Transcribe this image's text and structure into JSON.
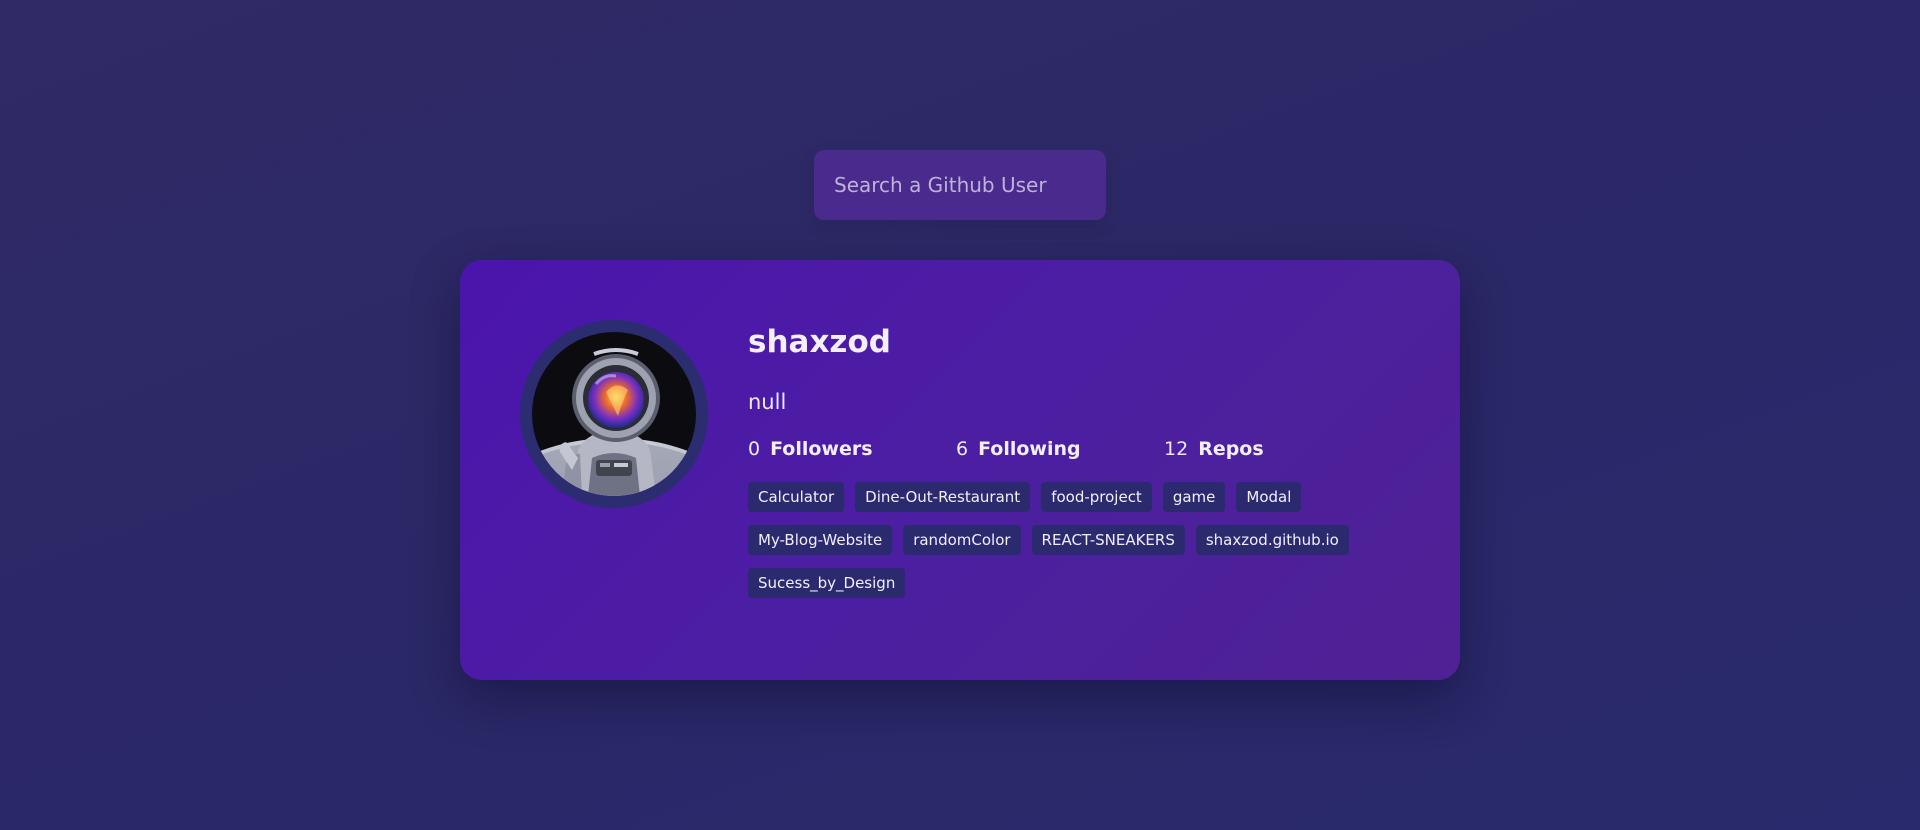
{
  "search": {
    "placeholder": "Search a Github User",
    "value": ""
  },
  "profile": {
    "username": "shaxzod",
    "bio": "null",
    "avatar_icon": "astronaut-avatar-image",
    "stats": {
      "followers": {
        "count": "0",
        "label": "Followers"
      },
      "following": {
        "count": "6",
        "label": "Following"
      },
      "repos": {
        "count": "12",
        "label": "Repos"
      }
    },
    "repos": [
      "Calculator",
      "Dine-Out-Restaurant",
      "food-project",
      "game",
      "Modal",
      "My-Blog-Website",
      "randomColor",
      "REACT-SNEAKERS",
      "shaxzod.github.io",
      "Sucess_by_Design"
    ]
  },
  "colors": {
    "background": "#2d2a69",
    "card_gradient_start": "#4b14ad",
    "card_gradient_end": "#4e2294",
    "search_bg": "#4a2a8c",
    "repo_chip_bg": "#2b2a6e",
    "avatar_ring": "#2c2c70"
  }
}
